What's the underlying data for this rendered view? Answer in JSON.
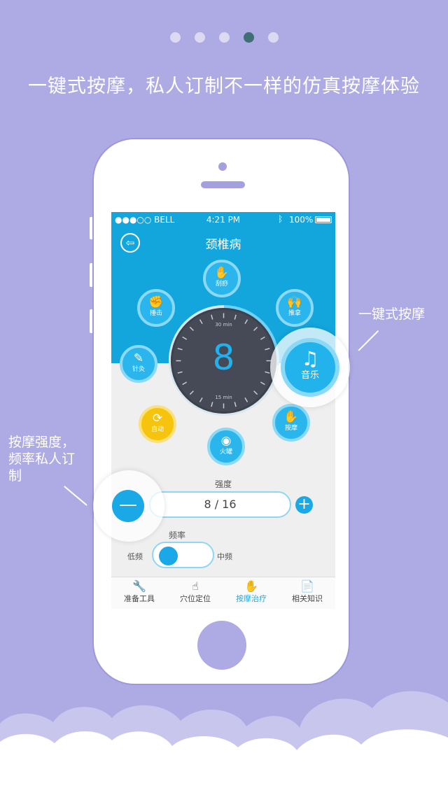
{
  "pager": {
    "count": 5,
    "active_index": 3
  },
  "headline": "一键式按摩，私人订制不一样的仿真按摩体验",
  "status_bar": {
    "carrier": "●●●○○ BELL",
    "time": "4:21 PM",
    "battery": "100%"
  },
  "nav": {
    "title": "颈椎病",
    "back_icon": "back-arrow-icon"
  },
  "bubbles": [
    {
      "label": "刮痧",
      "icon": "✋"
    },
    {
      "label": "推拿",
      "icon": "🙌"
    },
    {
      "label": "捶击",
      "icon": "✊"
    },
    {
      "label": "针灸",
      "icon": "✎"
    },
    {
      "label": "自动",
      "icon": "⟳"
    },
    {
      "label": "按摩",
      "icon": "✋"
    },
    {
      "label": "火罐",
      "icon": "◉"
    }
  ],
  "music": {
    "label": "音乐",
    "icon": "♫"
  },
  "dial": {
    "value": "8",
    "top_mark": "30 min",
    "bottom_mark": "15 min"
  },
  "strength": {
    "label": "强度",
    "value": "8 / 16",
    "minus": "—",
    "plus": "+"
  },
  "frequency": {
    "label": "频率",
    "low": "低频",
    "mid": "中频"
  },
  "tabs": [
    {
      "label": "准备工具",
      "icon": "🔧"
    },
    {
      "label": "穴位定位",
      "icon": "☝"
    },
    {
      "label": "按摩治疗",
      "icon": "✋"
    },
    {
      "label": "相关知识",
      "icon": "📄"
    }
  ],
  "callouts": {
    "right": "一键式按摩",
    "left_line1": "按摩强度，",
    "left_line2": "频率私人订",
    "left_line3": "制"
  },
  "colors": {
    "background": "#aeaae3",
    "accent": "#1aa9e6",
    "header": "#12a6dc",
    "dial": "#454a56",
    "yellow": "#f7c40d"
  }
}
